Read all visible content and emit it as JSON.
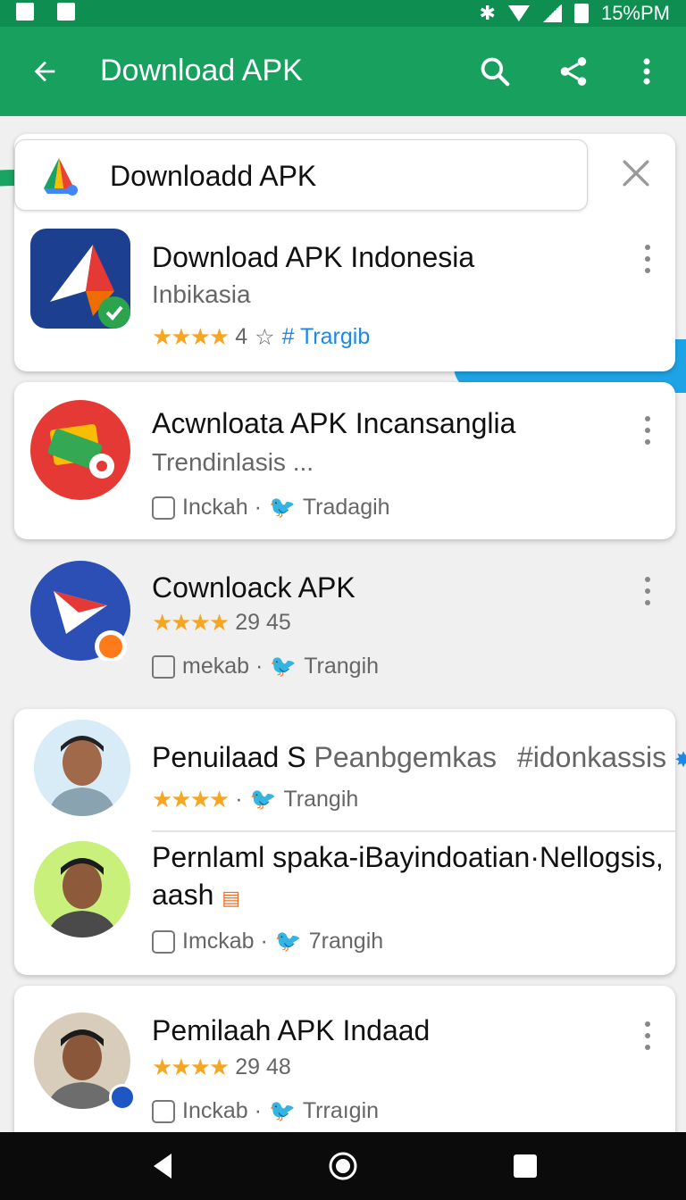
{
  "status_bar": {
    "time_text": "15%PM"
  },
  "app_bar": {
    "title": "Download APK"
  },
  "search": {
    "value": "Downloadd APK"
  },
  "results": [
    {
      "name": "Download APK Indonesia",
      "subtitle": "Inbikasia",
      "rating_text": "4",
      "tag": "# Trargib"
    },
    {
      "name": "Acwnloata APK Incansanglia",
      "subtitle": "Trendinlasis ...",
      "meta_left": "Inckah ·",
      "meta_right": "Tradagih"
    },
    {
      "name": "Cownloack APK",
      "rating_text": "29 45",
      "meta_left": "mekab ·",
      "meta_right": "Trangih"
    }
  ],
  "people": [
    {
      "name": "Penuilaad S",
      "name_suffix": "Peanbgemkas",
      "tag": "#idonkassis",
      "meta_right": "Trangih"
    },
    {
      "name": "Pernlaml spaka-iBayindoatian·Nellogsis,",
      "name_line2": "aash",
      "meta_left": "Imckab ·",
      "meta_right": "7rangih"
    }
  ],
  "last": {
    "name": "Pemilaah APK Indaad",
    "rating_text": "29 48",
    "meta_left": "Inckab ·",
    "meta_right": "Trraıgin"
  },
  "colors": {
    "primary": "#18a05e",
    "status": "#0e8e51",
    "star": "#f5a623",
    "link": "#1e88e5"
  },
  "icons": [
    "back-arrow-icon",
    "search-icon",
    "share-icon",
    "more-vert-icon",
    "close-icon",
    "star-icon",
    "instagram-icon",
    "twitter-icon",
    "verified-icon"
  ]
}
